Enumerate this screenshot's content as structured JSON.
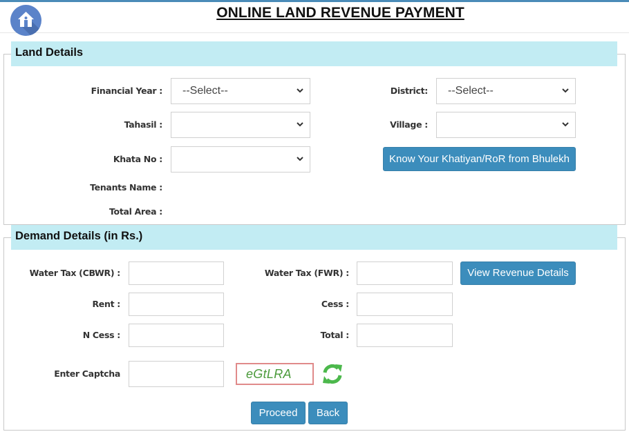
{
  "header": {
    "title": "ONLINE LAND REVENUE PAYMENT",
    "home_icon": "home-icon"
  },
  "land_details": {
    "legend": "Land Details",
    "financial_year": {
      "label": "Financial Year :",
      "value": "--Select--"
    },
    "district": {
      "label": "District:",
      "value": "--Select--"
    },
    "tahasil": {
      "label": "Tahasil :",
      "value": ""
    },
    "village": {
      "label": "Village :",
      "value": ""
    },
    "khata_no": {
      "label": "Khata No :",
      "value": ""
    },
    "bhulekh_button": "Know Your Khatiyan/RoR from Bhulekh",
    "tenants_name": {
      "label": "Tenants Name :",
      "value": ""
    },
    "total_area": {
      "label": "Total Area :",
      "value": ""
    }
  },
  "demand_details": {
    "legend": "Demand Details (in Rs.)",
    "water_tax_cbwr": {
      "label": "Water Tax (CBWR) :",
      "value": ""
    },
    "water_tax_fwr": {
      "label": "Water Tax (FWR) :",
      "value": ""
    },
    "view_revenue_button": "View Revenue Details",
    "rent": {
      "label": "Rent :",
      "value": ""
    },
    "cess": {
      "label": "Cess :",
      "value": ""
    },
    "n_cess": {
      "label": "N Cess :",
      "value": ""
    },
    "total": {
      "label": "Total :",
      "value": ""
    },
    "captcha": {
      "label": "Enter Captcha",
      "value": "",
      "code": "eGtLRA",
      "refresh_icon": "refresh-icon"
    },
    "proceed_button": "Proceed",
    "back_button": "Back"
  },
  "colors": {
    "accent": "#3c8dbc",
    "legend_bg": "#c2ecf3",
    "top_bar": "#4a8bb8",
    "home_icon_bg": "#5b83c9",
    "refresh_icon": "#4cb84c",
    "captcha_border": "#e08a8a",
    "captcha_text": "#4a9a3a"
  }
}
